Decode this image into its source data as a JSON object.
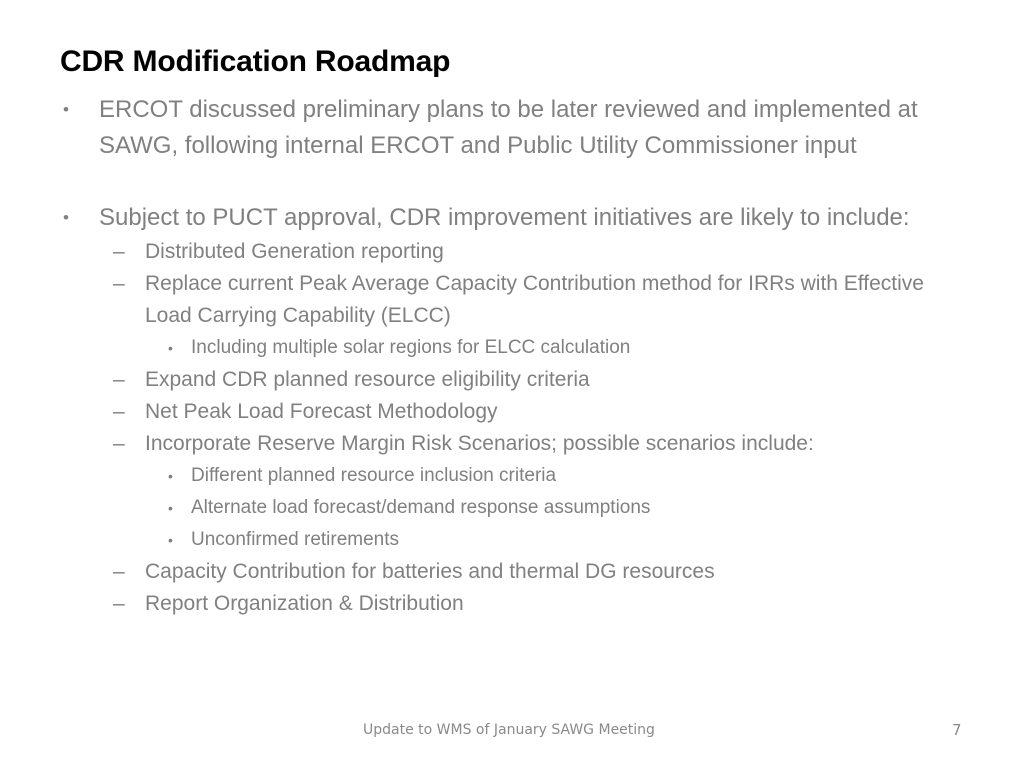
{
  "slide": {
    "title": "CDR Modification Roadmap",
    "title_color": "#000000",
    "body_color": "#808080",
    "background": "#ffffff"
  },
  "bullets": {
    "b1": {
      "marker": "•",
      "text": "ERCOT discussed preliminary plans to be later reviewed and implemented at SAWG, following internal ERCOT and Public Utility Commissioner input"
    },
    "b2": {
      "marker": "•",
      "text": "Subject to PUCT approval, CDR improvement initiatives are likely to include:"
    },
    "s1": {
      "marker": "–",
      "text": "Distributed Generation reporting"
    },
    "s2": {
      "marker": "–",
      "text": "Replace current Peak Average Capacity Contribution method for IRRs with Effective Load Carrying Capability (ELCC)"
    },
    "s2a": {
      "marker": "•",
      "text": "Including multiple solar regions for ELCC calculation"
    },
    "s3": {
      "marker": "–",
      "text": "Expand CDR planned resource eligibility criteria"
    },
    "s4": {
      "marker": "–",
      "text": "Net Peak Load Forecast Methodology"
    },
    "s5": {
      "marker": "–",
      "text": "Incorporate Reserve Margin Risk Scenarios; possible scenarios include:"
    },
    "s5a": {
      "marker": "•",
      "text": "Different planned resource inclusion criteria"
    },
    "s5b": {
      "marker": "•",
      "text": "Alternate load forecast/demand response assumptions"
    },
    "s5c": {
      "marker": "•",
      "text": "Unconfirmed retirements"
    },
    "s6": {
      "marker": "–",
      "text": "Capacity Contribution for batteries and thermal DG resources"
    },
    "s7": {
      "marker": "–",
      "text": "Report Organization & Distribution"
    }
  },
  "footer": {
    "text": "Update to WMS of January SAWG Meeting",
    "page_number": "7"
  }
}
